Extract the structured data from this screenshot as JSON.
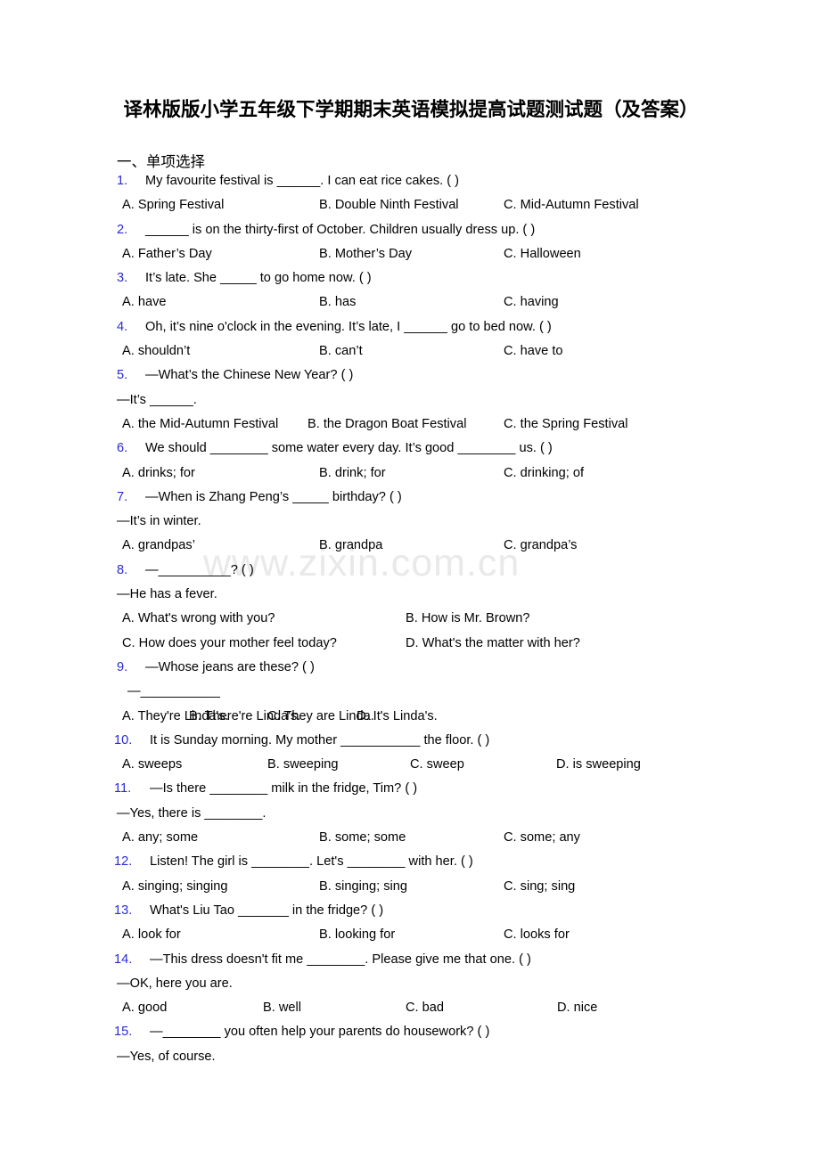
{
  "document": {
    "title": "译林版版小学五年级下学期期末英语模拟提高试题测试题（及答案）",
    "watermark": "www.zixin.com.cn",
    "section_heading": "一、单项选择"
  },
  "questions": [
    {
      "number": "1.",
      "stem": "My favourite festival is ______. I can eat rice cakes. (    )",
      "continuation": null,
      "layout": "c3",
      "options": [
        {
          "label": "A.",
          "text": "Spring Festival"
        },
        {
          "label": "B.",
          "text": "Double Ninth Festival"
        },
        {
          "label": "C.",
          "text": "Mid-Autumn Festival"
        }
      ]
    },
    {
      "number": "2.",
      "stem": "______ is on the thirty-first of October. Children usually dress up. (    )",
      "continuation": null,
      "layout": "c3",
      "options": [
        {
          "label": "A.",
          "text": "Father’s Day"
        },
        {
          "label": "B.",
          "text": "Mother’s Day"
        },
        {
          "label": "C.",
          "text": "Halloween"
        }
      ]
    },
    {
      "number": "3.",
      "stem": "It’s late. She _____ to go home now. (    )",
      "continuation": null,
      "layout": "c3",
      "options": [
        {
          "label": "A.",
          "text": "have"
        },
        {
          "label": "B.",
          "text": "has"
        },
        {
          "label": "C.",
          "text": "having"
        }
      ]
    },
    {
      "number": "4.",
      "stem": "Oh, it’s nine o'clock in the evening. It’s late, I ______ go to bed now. (  )",
      "continuation": null,
      "layout": "c3",
      "options": [
        {
          "label": "A.",
          "text": "shouldn’t"
        },
        {
          "label": "B.",
          "text": "can’t"
        },
        {
          "label": "C.",
          "text": "have to"
        }
      ]
    },
    {
      "number": "5.",
      "stem": "—What’s the Chinese New Year? (    )",
      "continuation": "—It’s ______.",
      "layout": "c3w",
      "options": [
        {
          "label": "A.",
          "text": "the Mid-Autumn Festival"
        },
        {
          "label": "B.",
          "text": "the Dragon Boat Festival"
        },
        {
          "label": "C.",
          "text": "the Spring Festival"
        }
      ]
    },
    {
      "number": "6.",
      "stem": "We should ________ some water every day. It’s good ________ us. (  )",
      "continuation": null,
      "layout": "c3",
      "options": [
        {
          "label": "A.",
          "text": "drinks; for"
        },
        {
          "label": "B.",
          "text": "drink; for"
        },
        {
          "label": "C.",
          "text": "drinking; of"
        }
      ]
    },
    {
      "number": "7.",
      "stem": "—When is Zhang Peng’s _____ birthday? (    )",
      "continuation": "—It’s in winter.",
      "layout": "c3",
      "options": [
        {
          "label": "A.",
          "text": "grandpas’"
        },
        {
          "label": "B.",
          "text": "grandpa"
        },
        {
          "label": "C.",
          "text": "grandpa’s"
        }
      ]
    },
    {
      "number": "8.",
      "stem": "—__________? (    )",
      "continuation": "—He has a fever.",
      "layout": "c2x2",
      "options": [
        {
          "label": "A.",
          "text": "What's wrong with you?"
        },
        {
          "label": "B.",
          "text": "How is Mr. Brown?"
        },
        {
          "label": "C.",
          "text": "How does your mother feel today?"
        },
        {
          "label": "D.",
          "text": "What's the matter with her?"
        }
      ]
    },
    {
      "number": "9.",
      "stem": "—Whose jeans are these? (  )",
      "continuation": "—___________",
      "continuation_indent": true,
      "layout": "c4x",
      "options": [
        {
          "label": "A.",
          "text": "They're Linda's."
        },
        {
          "label": "B.",
          "text": "There're Linda's."
        },
        {
          "label": "C.",
          "text": "They are Linda."
        },
        {
          "label": "D.",
          "text": "It's Linda's."
        }
      ]
    },
    {
      "number": "10.",
      "stem": "It is Sunday morning. My mother ___________ the floor. (  )",
      "continuation": null,
      "layout": "c4",
      "options": [
        {
          "label": "A.",
          "text": "sweeps"
        },
        {
          "label": "B.",
          "text": "sweeping"
        },
        {
          "label": "C.",
          "text": "sweep"
        },
        {
          "label": "D.",
          "text": "is sweeping"
        }
      ]
    },
    {
      "number": "11.",
      "stem": "—Is there ________ milk in the fridge, Tim? (  )",
      "continuation": "—Yes, there is ________.",
      "layout": "c3",
      "options": [
        {
          "label": "A.",
          "text": "any; some"
        },
        {
          "label": "B.",
          "text": "some; some"
        },
        {
          "label": "C.",
          "text": "some; any"
        }
      ]
    },
    {
      "number": "12.",
      "stem": "Listen! The girl is ________. Let's ________ with her. (   )",
      "continuation": null,
      "layout": "c3",
      "options": [
        {
          "label": "A.",
          "text": "singing; singing"
        },
        {
          "label": "B.",
          "text": "singing; sing"
        },
        {
          "label": "C.",
          "text": "sing; sing"
        }
      ]
    },
    {
      "number": "13.",
      "stem": "What's Liu Tao _______ in the fridge? (  )",
      "continuation": null,
      "layout": "c3",
      "options": [
        {
          "label": "A.",
          "text": "look for"
        },
        {
          "label": "B.",
          "text": "looking for"
        },
        {
          "label": "C.",
          "text": "looks for"
        }
      ]
    },
    {
      "number": "14.",
      "stem": "—This dress doesn't fit me ________. Please give me that one. (  )",
      "continuation": "—OK, here you are.",
      "layout": "c4w",
      "options": [
        {
          "label": "A.",
          "text": "good"
        },
        {
          "label": "B.",
          "text": "well"
        },
        {
          "label": "C.",
          "text": "bad"
        },
        {
          "label": "D.",
          "text": "nice"
        }
      ]
    },
    {
      "number": "15.",
      "stem": "—________ you often help your parents do housework? (  )",
      "continuation": "—Yes, of course.",
      "layout": "none",
      "options": []
    }
  ]
}
